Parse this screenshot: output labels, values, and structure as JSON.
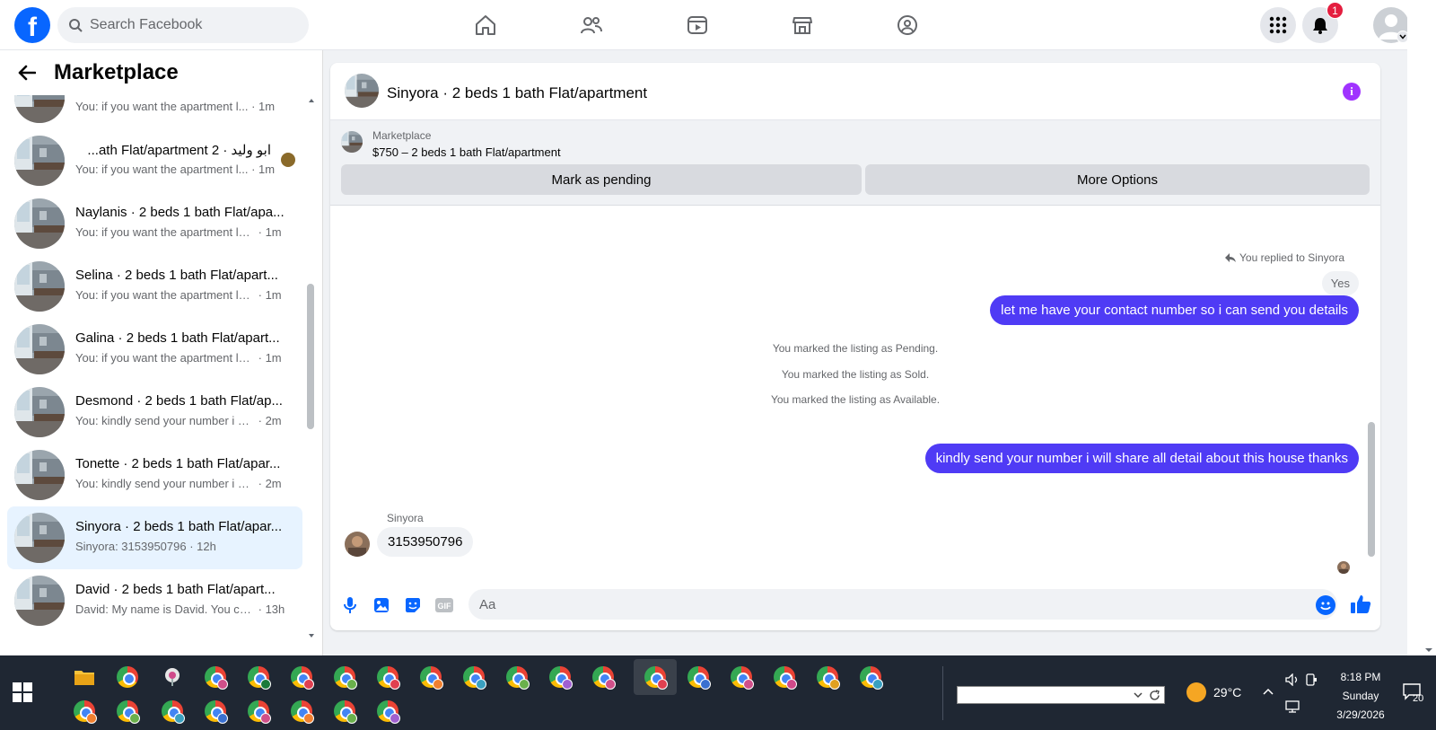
{
  "search": {
    "placeholder": "Search Facebook"
  },
  "nav": {
    "icons": [
      "home-icon",
      "friends-icon",
      "watch-icon",
      "marketplace-icon",
      "groups-icon"
    ]
  },
  "header_right": {
    "notifications_count": "1"
  },
  "sidebar": {
    "title": "Marketplace",
    "conversations": [
      {
        "title": "",
        "snippet": "You: if you want the apartment l...",
        "time": "1m"
      },
      {
        "title": "ابو وليد · 2 ath Flat/apartment...",
        "snippet": "You: if you want the apartment l...",
        "time": "1m"
      },
      {
        "title": "Naylanis · 2 beds 1 bath Flat/apa...",
        "snippet": "You: if you want the apartment let ...",
        "time": "1m"
      },
      {
        "title": "Selina · 2 beds 1 bath Flat/apart...",
        "snippet": "You: if you want the apartment let ...",
        "time": "1m"
      },
      {
        "title": "Galina · 2 beds 1 bath Flat/apart...",
        "snippet": "You: if you want the apartment let ...",
        "time": "1m"
      },
      {
        "title": "Desmond · 2 beds 1 bath Flat/ap...",
        "snippet": "You: kindly send your number i will...",
        "time": "2m"
      },
      {
        "title": "Tonette · 2 beds 1 bath Flat/apar...",
        "snippet": "You: kindly send your number i will...",
        "time": "2m"
      },
      {
        "title": "Sinyora · 2 beds 1 bath Flat/apar...",
        "snippet": "Sinyora: 3153950796",
        "time": "12h"
      },
      {
        "title": "David · 2 beds 1 bath Flat/apart...",
        "snippet": "David: My name is David. You can ...",
        "time": "13h"
      }
    ]
  },
  "chat": {
    "name": "Sinyora · 2 beds 1 bath Flat/apartment",
    "listing": {
      "category": "Marketplace",
      "description": "$750 – 2 beds 1 bath Flat/apartment",
      "pending_label": "Mark as pending",
      "more_label": "More Options"
    },
    "replied_note": "You replied to Sinyora",
    "quoted": "Yes",
    "msg1": "let me have your contact number so i can send you details",
    "system": [
      "You marked the listing as Pending.",
      "You marked the listing as Sold.",
      "You marked the listing as Available."
    ],
    "msg2": "kindly send your number i will share all detail about this house thanks",
    "sender": "Sinyora",
    "incoming": "3153950796",
    "composer_placeholder": "Aa"
  },
  "taskbar": {
    "weather": "29°C",
    "time": "8:18 PM",
    "day": "Sunday",
    "date": "3/29/2026",
    "notifications": "20"
  },
  "colors": {
    "brand": "#0866ff",
    "outgoing_bubble": "#4f3bf5",
    "active_row": "#e7f3ff",
    "info_icon": "#a033ff"
  }
}
